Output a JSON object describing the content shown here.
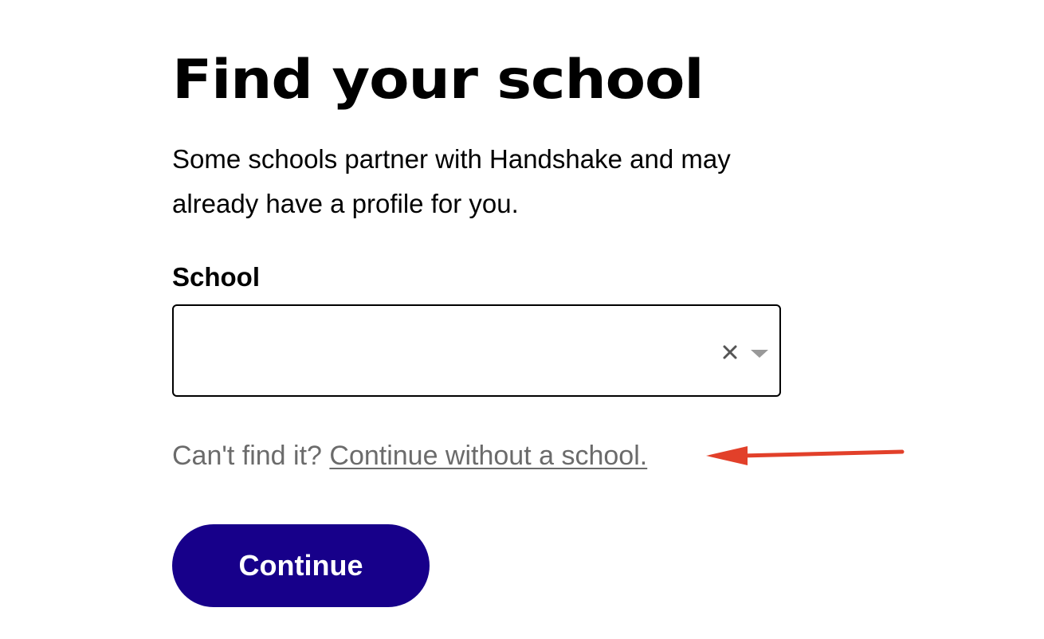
{
  "header": {
    "title": "Find your school",
    "subtitle": "Some schools partner with Handshake and may already have a profile for you."
  },
  "form": {
    "school_label": "School",
    "school_value": "",
    "school_placeholder": "",
    "clear_icon": "close-icon",
    "dropdown_icon": "caret-down-icon"
  },
  "help": {
    "prompt": "Can't find it? ",
    "link_label": "Continue without a school."
  },
  "actions": {
    "continue_label": "Continue"
  },
  "colors": {
    "primary_button": "#17008a",
    "link_text": "#6b6b6b",
    "annotation_arrow": "#e2402a"
  }
}
